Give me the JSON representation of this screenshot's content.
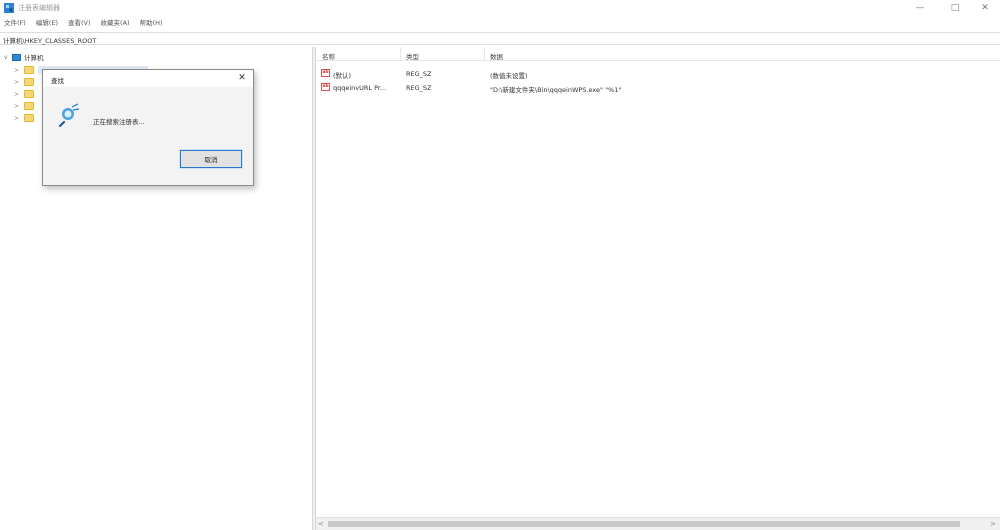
{
  "window": {
    "title": "注册表编辑器",
    "minimize": "—",
    "maximize": "□",
    "close": "✕"
  },
  "menu": [
    {
      "label": "文件(F)"
    },
    {
      "label": "编辑(E)"
    },
    {
      "label": "查看(V)"
    },
    {
      "label": "收藏夹(A)"
    },
    {
      "label": "帮助(H)"
    }
  ],
  "address": "计算机\\HKEY_CLASSES_ROOT",
  "tree": {
    "root_label": "计算机",
    "arrow_collapsed": ">",
    "arrow_expanded": "v"
  },
  "list": {
    "columns": [
      "名称",
      "类型",
      "数据"
    ],
    "rows": [
      {
        "name": "(默认)",
        "type": "REG_SZ",
        "data": "(数值未设置)",
        "icon": "ab"
      },
      {
        "name": "qqqeinvURL Pr...",
        "type": "REG_SZ",
        "data": "\"D:\\新建文件夹\\Bin\\qqqeinWPS.exe\" \"%1\"",
        "icon": "ab"
      }
    ]
  },
  "scrollbar": {
    "left_arrow": "<",
    "right_arrow": ">"
  },
  "dialog": {
    "title": "查找",
    "close": "✕",
    "message": "正在搜索注册表...",
    "cancel_label": "取消"
  },
  "colors": {
    "accent": "#2c75c9",
    "folder": "#f7d675",
    "pc_icon": "#2d89d6"
  }
}
